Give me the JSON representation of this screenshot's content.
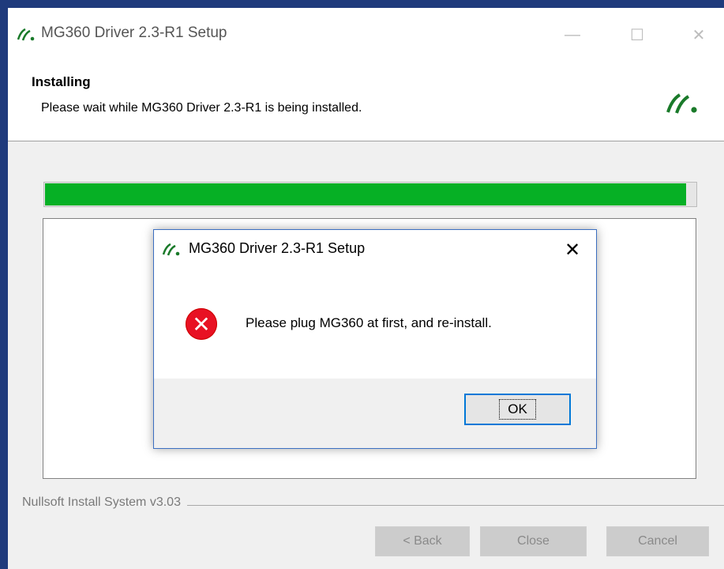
{
  "window": {
    "title": "MG360 Driver 2.3-R1 Setup",
    "controls": {
      "minimize": "—",
      "maximize": "☐",
      "close": "✕"
    }
  },
  "header": {
    "title": "Installing",
    "subtitle": "Please wait while MG360 Driver 2.3-R1 is being installed."
  },
  "progress": {
    "fraction": 0.985,
    "color": "#06b025"
  },
  "branding": "Nullsoft Install System v3.03",
  "buttons": {
    "back": "< Back",
    "close": "Close",
    "cancel": "Cancel"
  },
  "dialog": {
    "title": "MG360 Driver 2.3-R1 Setup",
    "close_glyph": "✕",
    "icon": "error-icon",
    "error_glyph": "✕",
    "message": "Please plug MG360 at first, and re-install.",
    "ok_label": "OK"
  },
  "colors": {
    "accent": "#0078d7",
    "error": "#e81123",
    "logo": "#1a7a2a"
  }
}
